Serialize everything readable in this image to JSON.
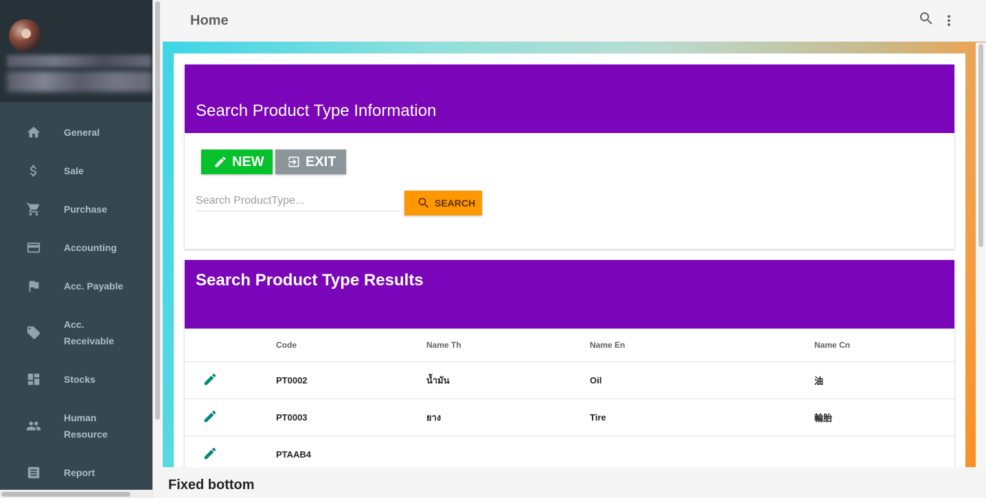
{
  "header": {
    "title": "Home"
  },
  "sidebar": {
    "items": [
      {
        "label": "General",
        "icon": "home-icon"
      },
      {
        "label": "Sale",
        "icon": "dollar-icon"
      },
      {
        "label": "Purchase",
        "icon": "cart-icon"
      },
      {
        "label": "Accounting",
        "icon": "credit-card-icon"
      },
      {
        "label": "Acc. Payable",
        "icon": "flag-icon"
      },
      {
        "label": "Acc. Receivable",
        "icon": "tag-icon"
      },
      {
        "label": "Stocks",
        "icon": "dashboard-icon"
      },
      {
        "label": "Human Resource",
        "icon": "people-icon"
      },
      {
        "label": "Report",
        "icon": "report-icon"
      }
    ]
  },
  "search_card": {
    "title": "Search Product Type Information",
    "new_label": "NEW",
    "exit_label": "EXIT",
    "search_placeholder": "Search ProductType...",
    "search_label": "SEARCH"
  },
  "results": {
    "title": "Search Product Type Results",
    "columns": [
      "",
      "Code",
      "Name Th",
      "Name En",
      "Name Cn"
    ],
    "rows": [
      {
        "code": "PT0002",
        "name_th": "น้ำมัน",
        "name_en": "Oil",
        "name_cn": "油"
      },
      {
        "code": "PT0003",
        "name_th": "ยาง",
        "name_en": "Tire",
        "name_cn": "輪胎"
      },
      {
        "code": "PTAAB4",
        "name_th": "",
        "name_en": "",
        "name_cn": ""
      }
    ]
  },
  "footer": {
    "text": "Fixed bottom"
  },
  "colors": {
    "card_header": "#7b05b8",
    "new_button": "#04c12c",
    "exit_button": "#8c9599",
    "search_button": "#ff9800",
    "sidebar": "#37474f"
  }
}
